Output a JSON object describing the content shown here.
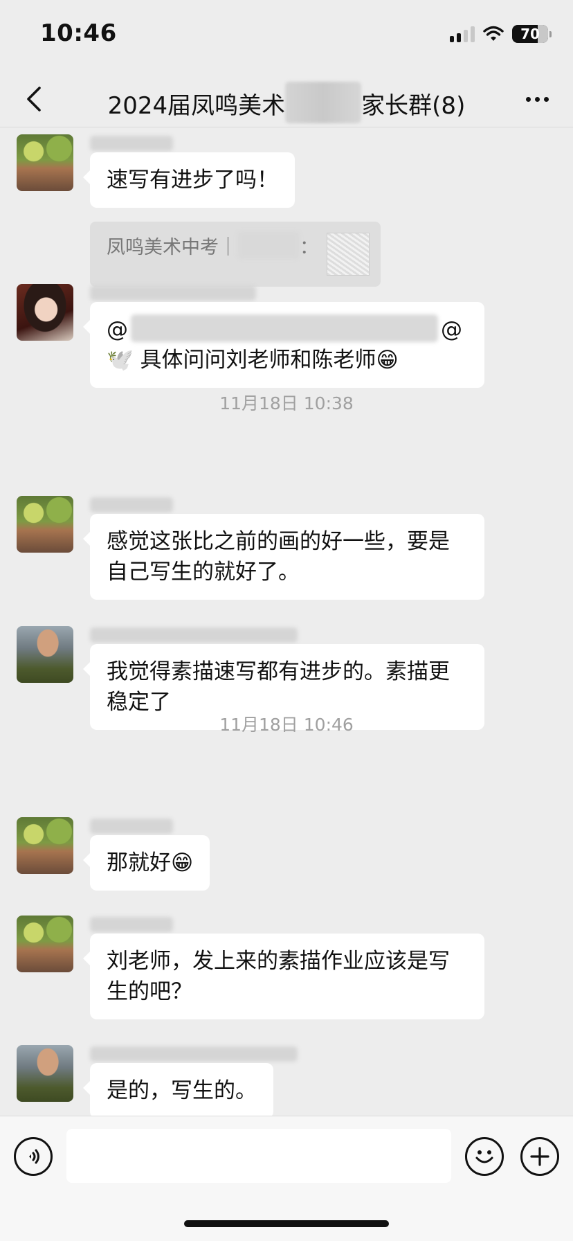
{
  "status": {
    "time": "10:46",
    "battery": "70"
  },
  "nav": {
    "title_left": "2024届凤鸣美术",
    "title_right": "家长群(8)"
  },
  "messages": [
    {
      "text": "速写有进步了吗！",
      "quote_label": "凤鸣美术中考｜",
      "quote_colon": "："
    },
    {
      "at_start": "@",
      "at_end": "@",
      "line2": "🕊️ 具体问问刘老师和陈老师😁"
    },
    {
      "text": "感觉这张比之前的画的好一些，要是自己写生的就好了。"
    },
    {
      "text": "我觉得素描速写都有进步的。素描更稳定了"
    },
    {
      "text": "那就好😁"
    },
    {
      "text": "刘老师，发上来的素描作业应该是写生的吧？"
    },
    {
      "text": "是的，写生的。"
    }
  ],
  "timestamps": [
    "11月18日 10:38",
    "11月18日 10:46"
  ],
  "input": {
    "placeholder": ""
  }
}
